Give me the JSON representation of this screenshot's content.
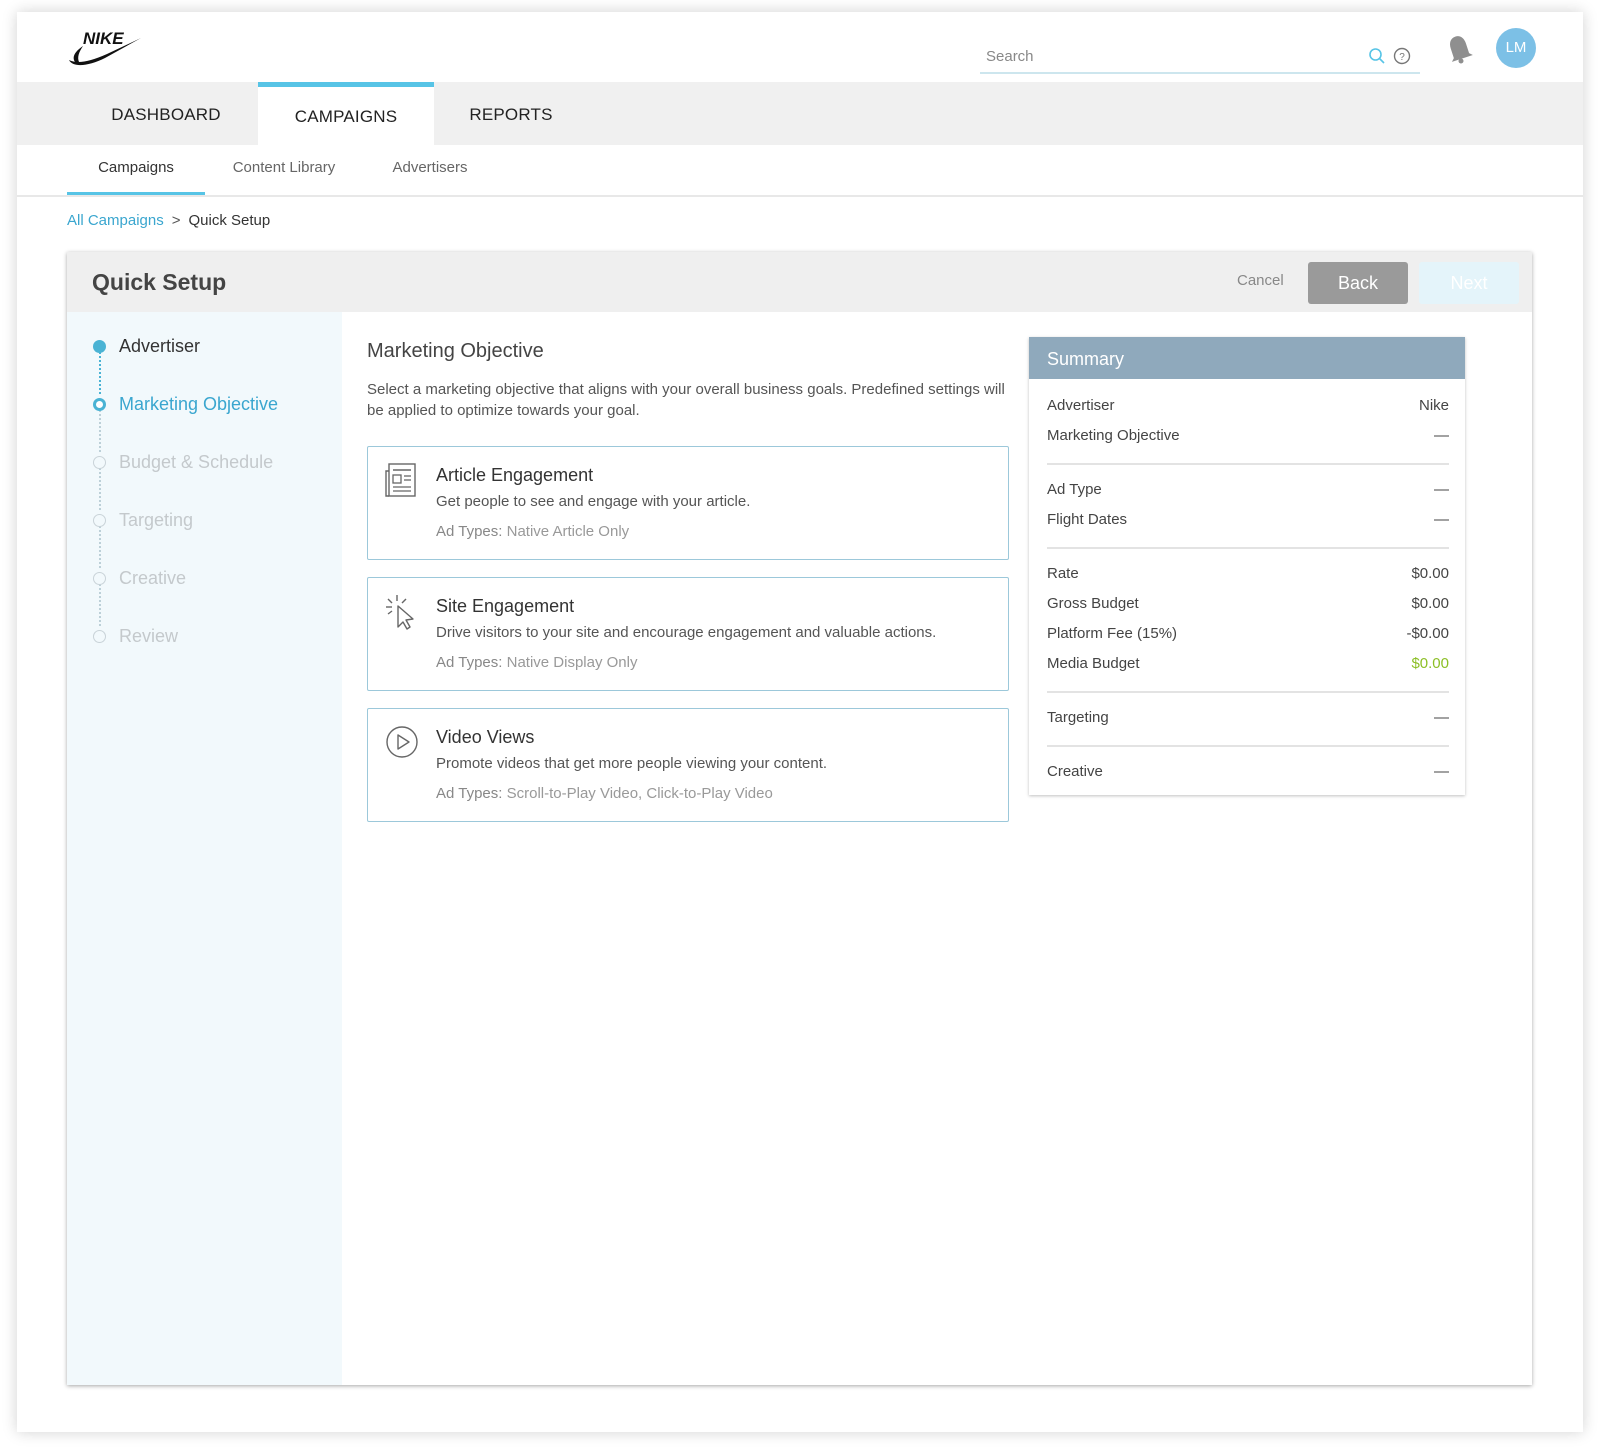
{
  "brand": {
    "logo_text": "NIKE"
  },
  "colors": {
    "accent": "#57c4e6",
    "link": "#3aa6cf",
    "summary_header": "#8fa9bc",
    "positive": "#8cbf26"
  },
  "search": {
    "placeholder": "Search"
  },
  "header": {
    "avatar_initials": "LM"
  },
  "main_nav": {
    "tabs": [
      {
        "label": "DASHBOARD",
        "active": false
      },
      {
        "label": "CAMPAIGNS",
        "active": true
      },
      {
        "label": "REPORTS",
        "active": false
      }
    ]
  },
  "sub_nav": {
    "items": [
      {
        "label": "Campaigns",
        "active": true
      },
      {
        "label": "Content Library",
        "active": false
      },
      {
        "label": "Advertisers",
        "active": false
      }
    ]
  },
  "breadcrumb": {
    "parent": "All Campaigns",
    "separator": ">",
    "current": "Quick Setup"
  },
  "card": {
    "title": "Quick Setup",
    "cancel_label": "Cancel",
    "back_label": "Back",
    "next_label": "Next"
  },
  "steps": [
    {
      "label": "Advertiser",
      "state": "done"
    },
    {
      "label": "Marketing Objective",
      "state": "current"
    },
    {
      "label": "Budget & Schedule",
      "state": "pending"
    },
    {
      "label": "Targeting",
      "state": "pending"
    },
    {
      "label": "Creative",
      "state": "pending"
    },
    {
      "label": "Review",
      "state": "pending"
    }
  ],
  "objective_section": {
    "title": "Marketing Objective",
    "description": "Select a marketing objective that aligns with your overall business goals. Predefined settings will be applied to optimize towards your goal.",
    "ad_types_key": "Ad Types:",
    "options": [
      {
        "icon": "article-icon",
        "title": "Article Engagement",
        "description": "Get people to see and engage with your article.",
        "ad_types": "Native Article Only"
      },
      {
        "icon": "cursor-click-icon",
        "title": "Site Engagement",
        "description": "Drive visitors to your site and encourage engagement and valuable actions.",
        "ad_types": "Native Display Only"
      },
      {
        "icon": "play-circle-icon",
        "title": "Video Views",
        "description": "Promote videos that get more people viewing your content.",
        "ad_types": "Scroll-to-Play Video, Click-to-Play Video"
      }
    ]
  },
  "summary": {
    "title": "Summary",
    "rows": {
      "advertiser": {
        "label": "Advertiser",
        "value": "Nike"
      },
      "marketing_objective": {
        "label": "Marketing Objective",
        "value": "—"
      },
      "ad_type": {
        "label": "Ad Type",
        "value": "—"
      },
      "flight_dates": {
        "label": "Flight Dates",
        "value": "—"
      },
      "rate": {
        "label": "Rate",
        "value": "$0.00"
      },
      "gross_budget": {
        "label": "Gross Budget",
        "value": "$0.00"
      },
      "platform_fee": {
        "label": "Platform Fee (15%)",
        "value": "-$0.00"
      },
      "media_budget": {
        "label": "Media Budget",
        "value": "$0.00"
      },
      "targeting": {
        "label": "Targeting",
        "value": "—"
      },
      "creative": {
        "label": "Creative",
        "value": "—"
      }
    }
  }
}
